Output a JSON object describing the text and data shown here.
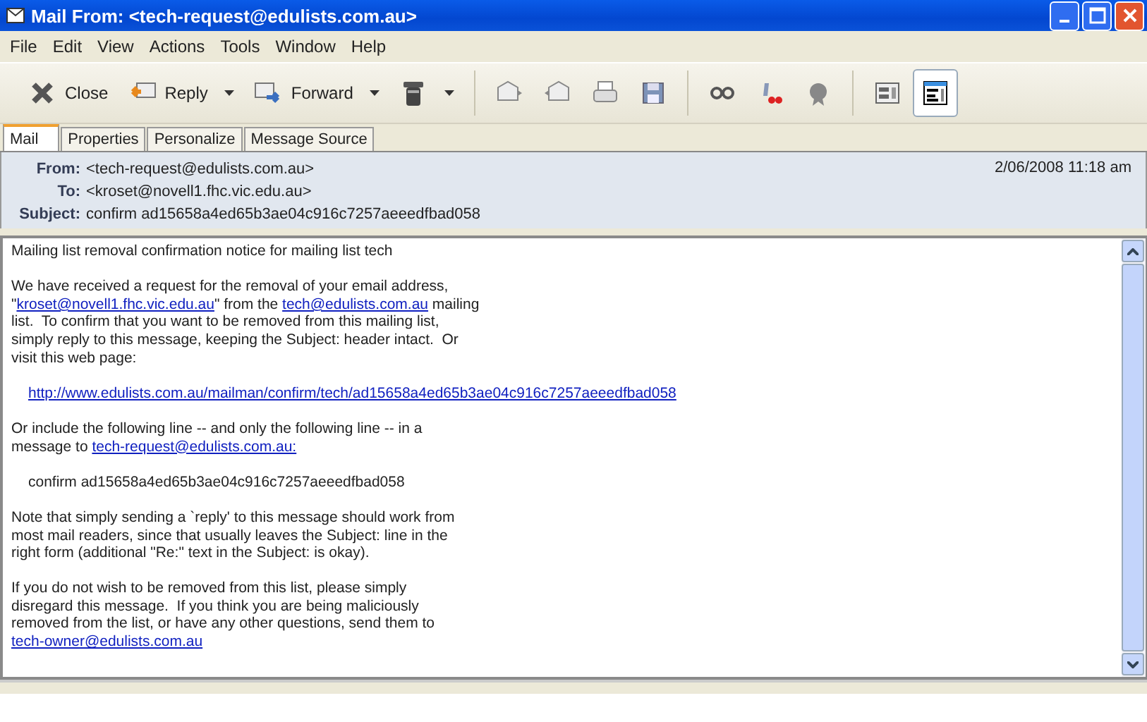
{
  "window": {
    "title": "Mail From: <tech-request@edulists.com.au>"
  },
  "menu": [
    "File",
    "Edit",
    "View",
    "Actions",
    "Tools",
    "Window",
    "Help"
  ],
  "toolbar": [
    {
      "kind": "labeled",
      "label": "Close",
      "dropdown": false
    },
    {
      "kind": "labeled",
      "label": "Reply",
      "dropdown": true
    },
    {
      "kind": "labeled",
      "label": "Forward",
      "dropdown": true
    },
    {
      "kind": "icon",
      "dropdown": true,
      "selected": false
    },
    {
      "kind": "separator"
    },
    {
      "kind": "icon",
      "dropdown": false,
      "selected": false
    },
    {
      "kind": "icon",
      "dropdown": false,
      "selected": false
    },
    {
      "kind": "icon",
      "dropdown": false,
      "selected": false
    },
    {
      "kind": "icon",
      "dropdown": false,
      "selected": false
    },
    {
      "kind": "separator"
    },
    {
      "kind": "icon",
      "dropdown": false,
      "selected": false
    },
    {
      "kind": "icon",
      "dropdown": false,
      "selected": false
    },
    {
      "kind": "icon",
      "dropdown": false,
      "selected": false
    },
    {
      "kind": "separator"
    },
    {
      "kind": "icon",
      "dropdown": false,
      "selected": false
    },
    {
      "kind": "icon",
      "dropdown": false,
      "selected": true
    }
  ],
  "tabs": [
    {
      "label": "Mail",
      "selected": true
    },
    {
      "label": "Properties",
      "selected": false
    },
    {
      "label": "Personalize",
      "selected": false
    },
    {
      "label": "Message Source",
      "selected": false
    }
  ],
  "header": {
    "fields": [
      {
        "label": "From:",
        "value": "<tech-request@edulists.com.au>"
      },
      {
        "label": "To:",
        "value": "<kroset@novell1.fhc.vic.edu.au>"
      },
      {
        "label": "Subject:",
        "value": "confirm ad15658a4ed65b3ae04c916c7257aeeedfbad058"
      }
    ],
    "date": "2/06/2008 11:18 am"
  },
  "body": [
    {
      "kind": "plain",
      "lines": [
        [
          {
            "kind": "text",
            "text": "Mailing list removal confirmation notice for mailing list tech"
          }
        ]
      ]
    },
    {
      "kind": "plain",
      "lines": [
        [
          {
            "kind": "text",
            "text": "We have received a request for the removal of your email address,"
          }
        ],
        [
          {
            "kind": "text",
            "text": "\""
          },
          {
            "kind": "link",
            "text": "kroset@novell1.fhc.vic.edu.au"
          },
          {
            "kind": "text",
            "text": "\" from the "
          },
          {
            "kind": "link",
            "text": "tech@edulists.com.au"
          },
          {
            "kind": "text",
            "text": " mailing"
          }
        ],
        [
          {
            "kind": "text",
            "text": "list.  To confirm that you want to be removed from this mailing list,"
          }
        ],
        [
          {
            "kind": "text",
            "text": "simply reply to this message, keeping the Subject: header intact.  Or"
          }
        ],
        [
          {
            "kind": "text",
            "text": "visit this web page:"
          }
        ]
      ]
    },
    {
      "kind": "indented",
      "lines": [
        [
          {
            "kind": "link",
            "text": "http://www.edulists.com.au/mailman/confirm/tech/ad15658a4ed65b3ae04c916c7257aeeedfbad058"
          }
        ]
      ]
    },
    {
      "kind": "plain",
      "lines": [
        [
          {
            "kind": "text",
            "text": "Or include the following line -- and only the following line -- in a"
          }
        ],
        [
          {
            "kind": "text",
            "text": "message to "
          },
          {
            "kind": "link",
            "text": "tech-request@edulists.com.au:"
          }
        ]
      ]
    },
    {
      "kind": "indented",
      "lines": [
        [
          {
            "kind": "text",
            "text": "confirm ad15658a4ed65b3ae04c916c7257aeeedfbad058"
          }
        ]
      ]
    },
    {
      "kind": "plain",
      "lines": [
        [
          {
            "kind": "text",
            "text": "Note that simply sending a `reply' to this message should work from"
          }
        ],
        [
          {
            "kind": "text",
            "text": "most mail readers, since that usually leaves the Subject: line in the"
          }
        ],
        [
          {
            "kind": "text",
            "text": "right form (additional \"Re:\" text in the Subject: is okay)."
          }
        ]
      ]
    },
    {
      "kind": "plain",
      "lines": [
        [
          {
            "kind": "text",
            "text": "If you do not wish to be removed from this list, please simply"
          }
        ],
        [
          {
            "kind": "text",
            "text": "disregard this message.  If you think you are being maliciously"
          }
        ],
        [
          {
            "kind": "text",
            "text": "removed from the list, or have any other questions, send them to"
          }
        ],
        [
          {
            "kind": "link",
            "text": "tech-owner@edulists.com.au"
          }
        ]
      ]
    }
  ]
}
